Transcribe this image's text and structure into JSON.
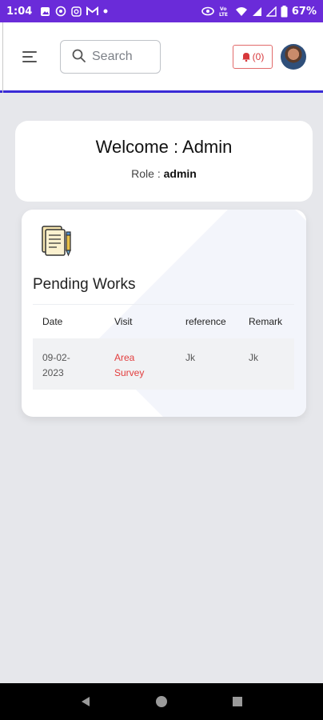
{
  "status_bar": {
    "time": "1:04",
    "battery": "67%",
    "volte": "Vo\nLTE"
  },
  "header": {
    "search_placeholder": "Search",
    "notifications_label": "(0)"
  },
  "welcome": {
    "title": "Welcome : Admin",
    "role_label": "Role : ",
    "role_value": "admin"
  },
  "pending": {
    "title": "Pending Works",
    "columns": [
      "Date",
      "Visit",
      "reference",
      "Remark"
    ],
    "rows": [
      {
        "date": "09-02-\n2023",
        "visit": "Area\nSurvey",
        "reference": "Jk",
        "remark": "Jk"
      }
    ]
  },
  "colors": {
    "status_bar": "#6a2bd9",
    "accent": "#3a2bd6",
    "visit_text": "#e23d3d",
    "notification": "#d7383b"
  }
}
